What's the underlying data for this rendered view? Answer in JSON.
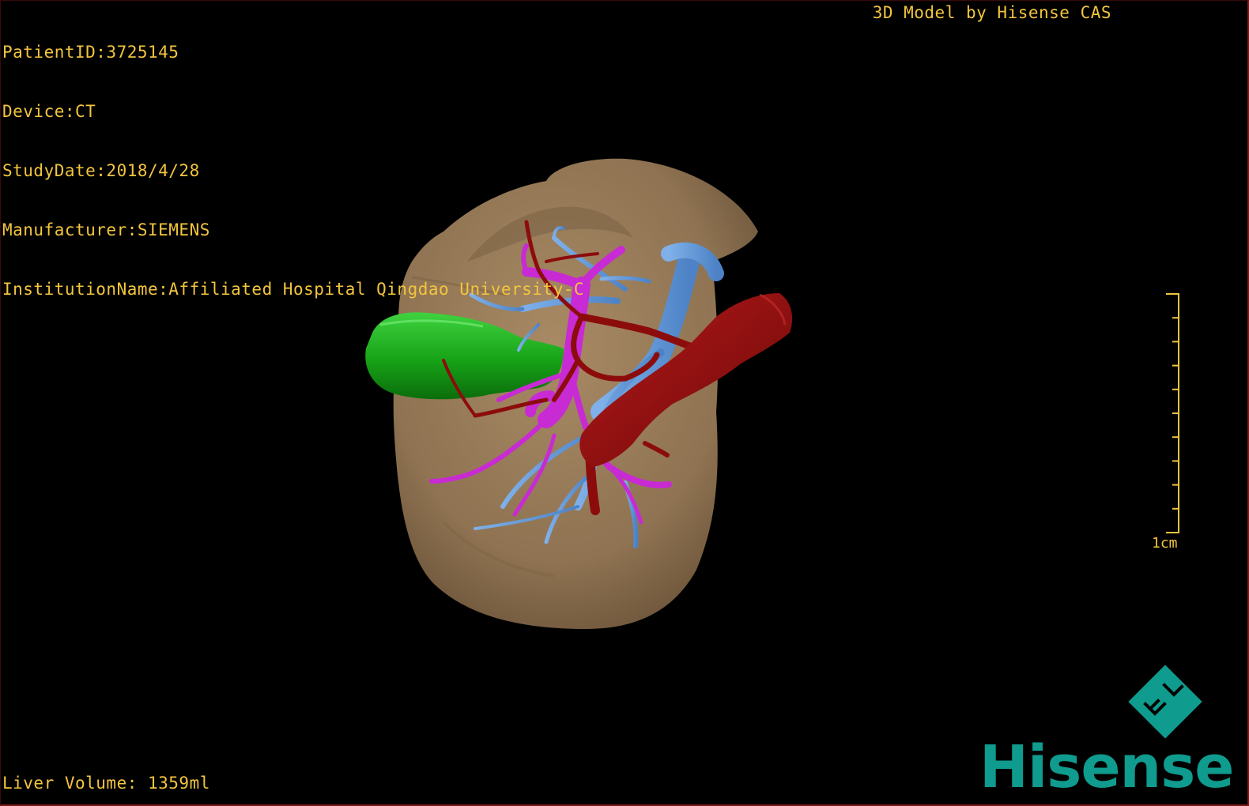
{
  "overlay": {
    "info_lines": [
      "PatientID:3725145",
      "Device:CT",
      "StudyDate:2018/4/28",
      "Manufacturer:SIEMENS",
      "InstitutionName:Affiliated Hospital Qingdao University-C"
    ],
    "brand_text": "3D Model by Hisense CAS",
    "volume_text": "Liver Volume: 1359ml",
    "text_color": "#f2c53d"
  },
  "scale": {
    "label": "1cm",
    "tick_count": 10
  },
  "model": {
    "structures": [
      "liver",
      "gallbladder",
      "hepatic-vein",
      "portal-vein",
      "hepatic-artery"
    ],
    "colors": {
      "liver": "#9b7e5a",
      "gallbladder": "#16a216",
      "hepatic_vein": "#5f96d6",
      "portal_vein": "#c82ad4",
      "artery": "#8c0c0c"
    }
  },
  "logo": {
    "mark_letters": "F L",
    "wordmark": "Hisense",
    "color": "#0f9b8e"
  }
}
